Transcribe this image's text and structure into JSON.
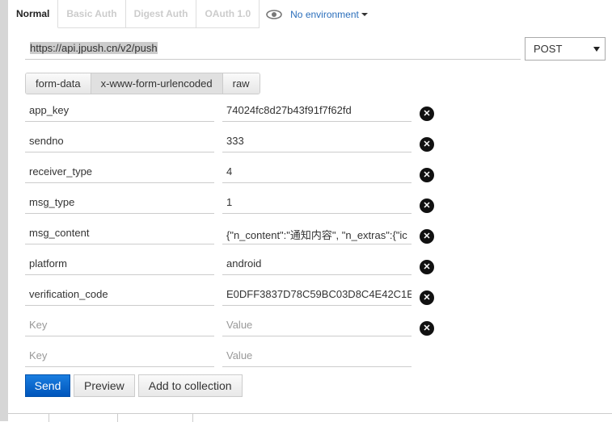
{
  "tabs": [
    "Normal",
    "Basic Auth",
    "Digest Auth",
    "OAuth 1.0"
  ],
  "environment": {
    "icon": "eye-icon",
    "label": "No environment"
  },
  "url": "https://api.jpush.cn/v2/push",
  "method": "POST",
  "body_types": [
    "form-data",
    "x-www-form-urlencoded",
    "raw"
  ],
  "selected_body_type": "x-www-form-urlencoded",
  "params": [
    {
      "key": "app_key",
      "value": "74024fc8d27b43f91f7f62fd"
    },
    {
      "key": "sendno",
      "value": "333"
    },
    {
      "key": "receiver_type",
      "value": "4"
    },
    {
      "key": "msg_type",
      "value": "1"
    },
    {
      "key": "msg_content",
      "value": "{\"n_content\":\"通知内容\", \"n_extras\":{\"ic"
    },
    {
      "key": "platform",
      "value": "android"
    },
    {
      "key": "verification_code",
      "value": "E0DFF3837D78C59BC03D8C4E42C1E"
    }
  ],
  "placeholders": {
    "key": "Key",
    "value": "Value"
  },
  "actions": {
    "send": "Send",
    "preview": "Preview",
    "add": "Add to collection"
  }
}
